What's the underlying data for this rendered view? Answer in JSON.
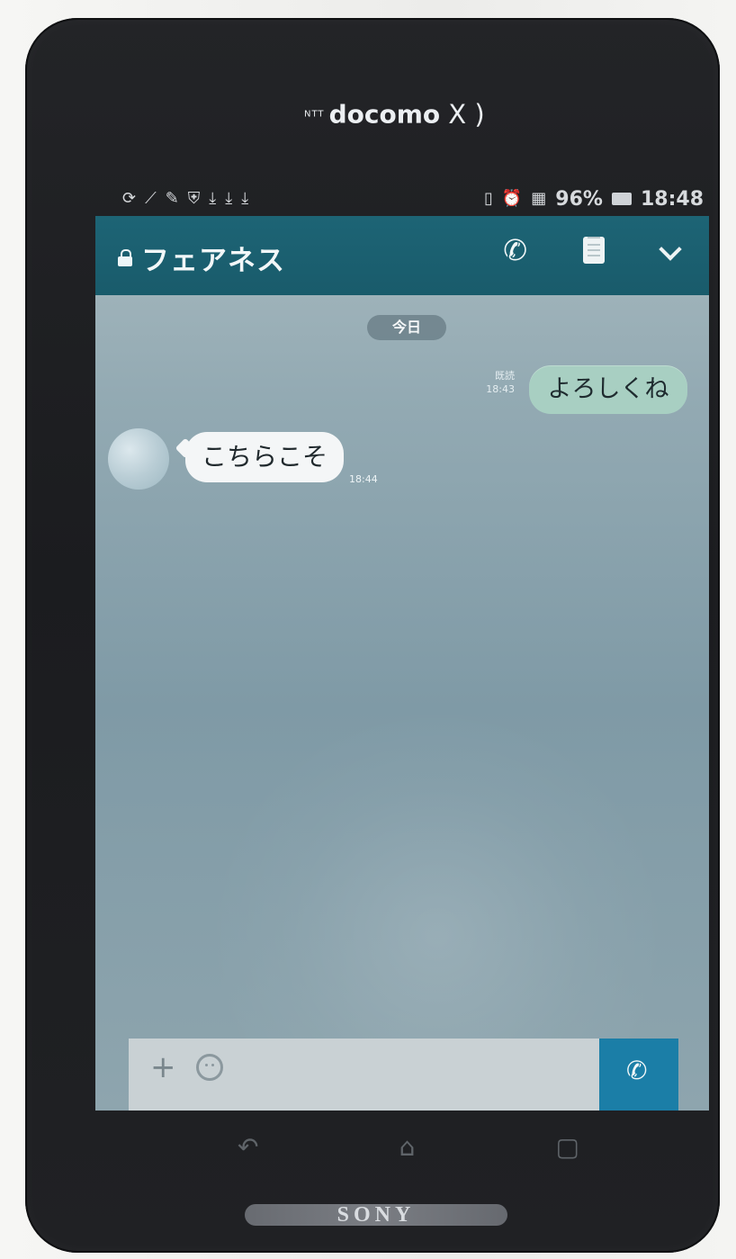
{
  "device": {
    "carrier_prefix": "NTT",
    "carrier_name": "docomo",
    "carrier_mark": "X )",
    "manufacturer": "SONY"
  },
  "status_bar": {
    "left_icons": [
      "sync-icon",
      "signal-icon",
      "wrench-icon",
      "shield-icon",
      "download-icon",
      "download-icon",
      "download-icon"
    ],
    "right_icons": [
      "vibrate-icon",
      "alarm-icon",
      "network-icon"
    ],
    "battery_percent": "96%",
    "time": "18:48"
  },
  "chat": {
    "title": "フェアネス",
    "date_label": "今日",
    "outgoing_message": {
      "status": "既読",
      "time": "18:43",
      "text": "よろしくね"
    },
    "incoming_message": {
      "text": "こちらこそ",
      "time": "18:44"
    }
  },
  "composer": {
    "plus_symbol": "+",
    "send_icon_name": "phone-icon"
  },
  "colors": {
    "header": "#1d6475",
    "outgoing_bubble": "#a8cfc2",
    "incoming_bubble": "#f4f6f7",
    "accent_button": "#1b7ea7"
  }
}
